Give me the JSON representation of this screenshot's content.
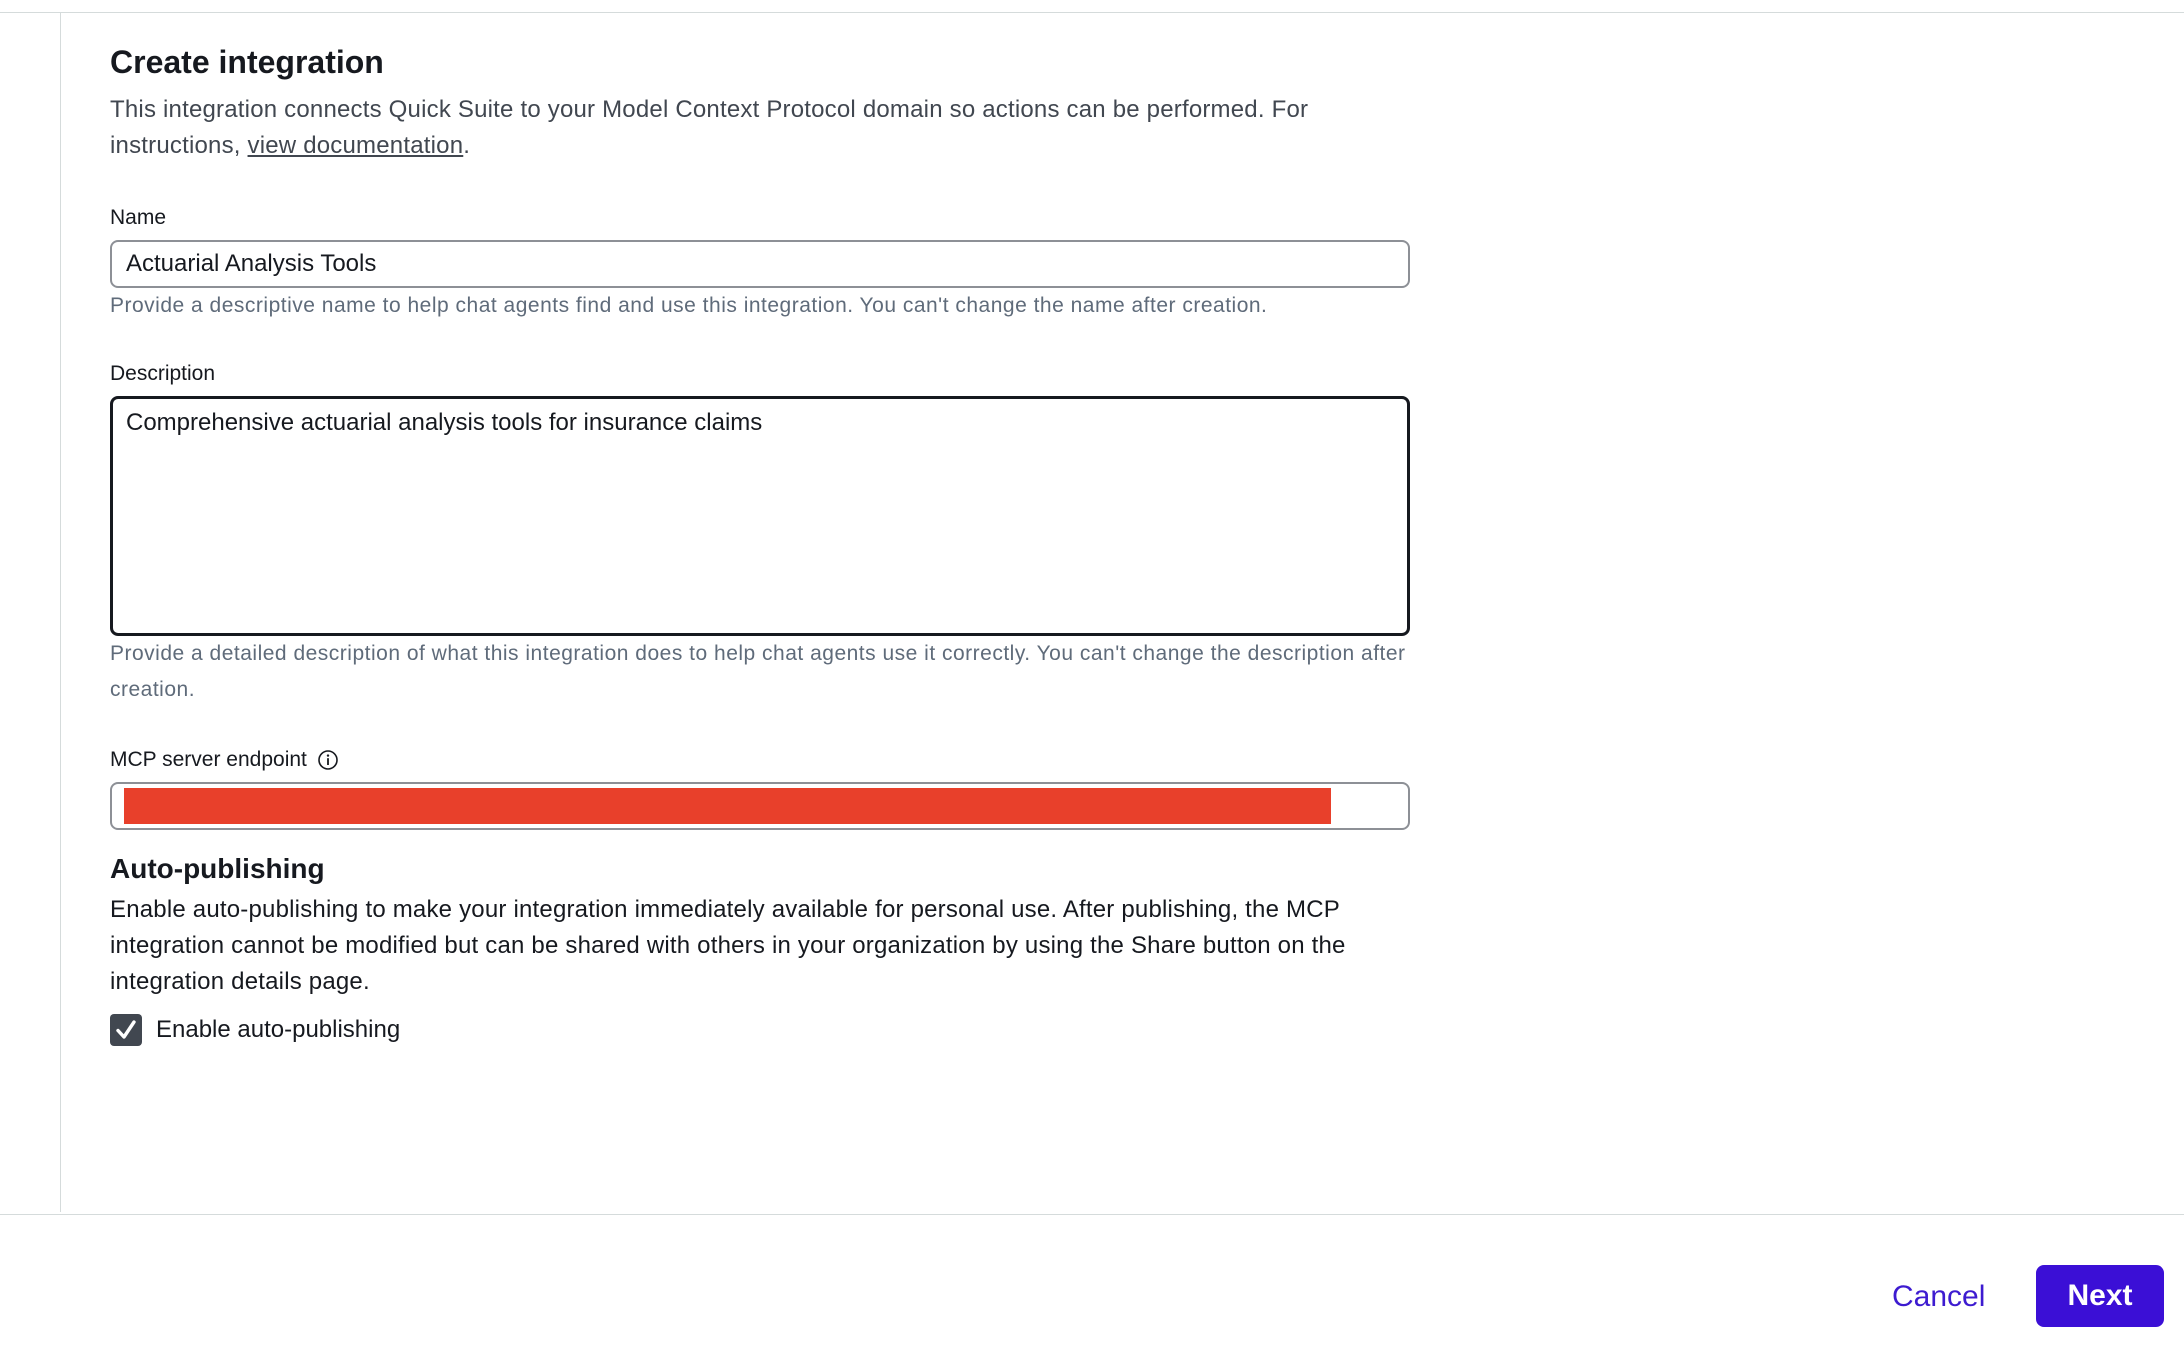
{
  "page": {
    "title": "Create integration",
    "intro_text": "This integration connects Quick Suite to your Model Context Protocol domain so actions can be performed. For instructions, ",
    "intro_link": "view documentation",
    "intro_end": "."
  },
  "name_field": {
    "label": "Name",
    "value": "Actuarial Analysis Tools",
    "hint": "Provide a descriptive name to help chat agents find and use this integration. You can't change the name after creation."
  },
  "description_field": {
    "label": "Description",
    "value": "Comprehensive actuarial analysis tools for insurance claims",
    "hint": "Provide a detailed description of what this integration does to help chat agents use it correctly. You can't change the description after creation."
  },
  "endpoint_field": {
    "label": "MCP server endpoint",
    "info_icon": "info-circle-icon",
    "value_redacted": true,
    "redaction_color": "#e8402b"
  },
  "auto_publishing": {
    "heading": "Auto-publishing",
    "body": "Enable auto-publishing to make your integration immediately available for personal use. After publishing, the MCP integration cannot be modified but can be shared with others in your organization by using the Share button on the integration details page.",
    "checkbox_label": "Enable auto-publishing",
    "checked": true
  },
  "footer": {
    "cancel_label": "Cancel",
    "next_label": "Next"
  },
  "colors": {
    "primary": "#3b0fd6",
    "link": "#3d1bd0",
    "text": "#16191f",
    "muted": "#5f6b7a"
  }
}
